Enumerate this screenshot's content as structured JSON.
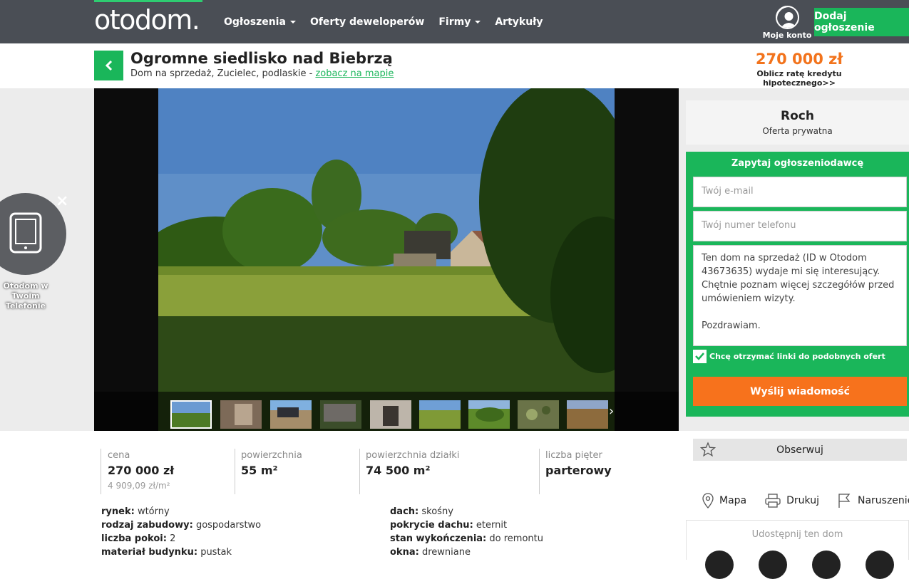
{
  "header": {
    "logo": "otodom.",
    "nav": [
      {
        "label": "Ogłoszenia",
        "dropdown": true
      },
      {
        "label": "Oferty deweloperów",
        "dropdown": false
      },
      {
        "label": "Firmy",
        "dropdown": true
      },
      {
        "label": "Artykuły",
        "dropdown": false
      }
    ],
    "account_label": "Moje konto",
    "add_button": "Dodaj ogłoszenie"
  },
  "listing": {
    "title": "Ogromne siedlisko nad Biebrzą",
    "subtitle": "Dom na sprzedaż, Zucielec, podlaskie - ",
    "map_link": "zobacz na mapie",
    "price": "270 000 zł",
    "mortgage_link": "Oblicz ratę kredytu hipotecznego>>"
  },
  "promo": {
    "text": "Otodom w Twoim Telefonie"
  },
  "gallery": {
    "thumbnail_count": 9,
    "active_index": 0
  },
  "seller": {
    "name": "Roch",
    "type": "Oferta prywatna"
  },
  "contact_form": {
    "heading": "Zapytaj ogłoszeniodawcę",
    "email_placeholder": "Twój e-mail",
    "phone_placeholder": "Twój numer telefonu",
    "message": "Ten dom na sprzedaż (ID w Otodom 43673635) wydaje mi się interesujący. Chętnie poznam więcej szczegółów przed umówieniem wizyty.\n\nPozdrawiam.",
    "checkbox_label": "Chcę otrzymać linki do podobnych ofert",
    "checkbox_checked": true,
    "send_button": "Wyślij wiadomość"
  },
  "sidebar_actions": {
    "watch": "Obserwuj",
    "map": "Mapa",
    "print": "Drukuj",
    "report": "Naruszenie",
    "share_heading": "Udostępnij ten dom"
  },
  "stats": [
    {
      "label": "cena",
      "value": "270 000 zł",
      "sub": "4 909,09 zł/m²"
    },
    {
      "label": "powierzchnia",
      "value": "55 m²"
    },
    {
      "label": "powierzchnia działki",
      "value": "74 500 m²"
    },
    {
      "label": "liczba pięter",
      "value": "parterowy"
    }
  ],
  "params_left": [
    {
      "key": "rynek:",
      "value": "wtórny"
    },
    {
      "key": "rodzaj zabudowy:",
      "value": "gospodarstwo"
    },
    {
      "key": "liczba pokoi:",
      "value": "2"
    },
    {
      "key": "materiał budynku:",
      "value": "pustak"
    }
  ],
  "params_right": [
    {
      "key": "dach:",
      "value": "skośny"
    },
    {
      "key": "pokrycie dachu:",
      "value": "eternit"
    },
    {
      "key": "stan wykończenia:",
      "value": "do remontu"
    },
    {
      "key": "okna:",
      "value": "drewniane"
    }
  ],
  "colors": {
    "nav_bg": "#4a4e55",
    "brand_green": "#1ab65a",
    "price_orange": "#f2731c",
    "send_orange": "#f7721c"
  }
}
